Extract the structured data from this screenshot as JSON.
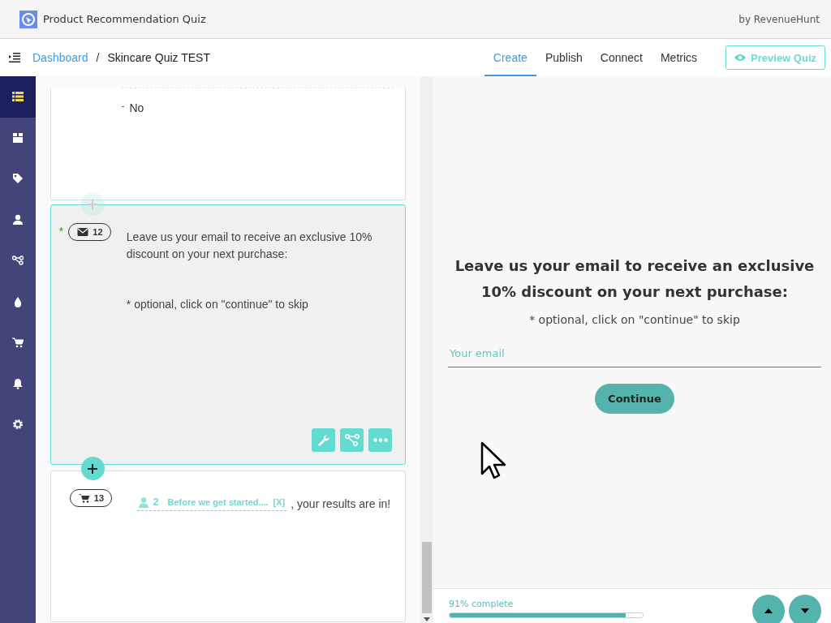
{
  "app": {
    "title": "Product Recommendation Quiz",
    "byline": "by RevenueHunt"
  },
  "breadcrumb": {
    "link": "Dashboard",
    "separator": "/",
    "current": "Skincare Quiz TEST"
  },
  "tabs": [
    {
      "label": "Create",
      "selected": true
    },
    {
      "label": "Publish",
      "selected": false
    },
    {
      "label": "Connect",
      "selected": false
    },
    {
      "label": "Metrics",
      "selected": false
    }
  ],
  "preview_button": "Preview Quiz",
  "sidebar": {
    "items": [
      {
        "selected": true
      },
      {
        "selected": false
      },
      {
        "selected": false
      },
      {
        "selected": false
      },
      {
        "selected": false
      },
      {
        "selected": false
      },
      {
        "selected": false
      },
      {
        "selected": false
      },
      {
        "selected": false
      }
    ]
  },
  "questions": [
    {
      "kind": "options",
      "selected": false,
      "options": [
        {
          "marker": "-",
          "label": "No"
        }
      ]
    },
    {
      "kind": "email",
      "selected": true,
      "required": true,
      "required_mark": "*",
      "number": "12",
      "text": "Leave us your email to receive an exclusive 10% discount on your next purchase:",
      "subtext": "* optional, click on \"continue\" to skip"
    },
    {
      "kind": "result",
      "selected": false,
      "number": "13",
      "variable": {
        "number": "2",
        "label": "Before we get started....",
        "remove": "[X]"
      },
      "text": ", your results are in!"
    }
  ],
  "add_buttons": [
    {
      "active": false
    },
    {
      "active": true
    }
  ],
  "preview": {
    "heading": "Leave us your email to receive an exclusive 10% discount on your next purchase:",
    "subtext": "* optional, click on \"continue\" to skip",
    "email": {
      "placeholder": "Your email"
    },
    "continue": "Continue",
    "progress": {
      "label": "91% complete",
      "level": 0.91
    }
  }
}
